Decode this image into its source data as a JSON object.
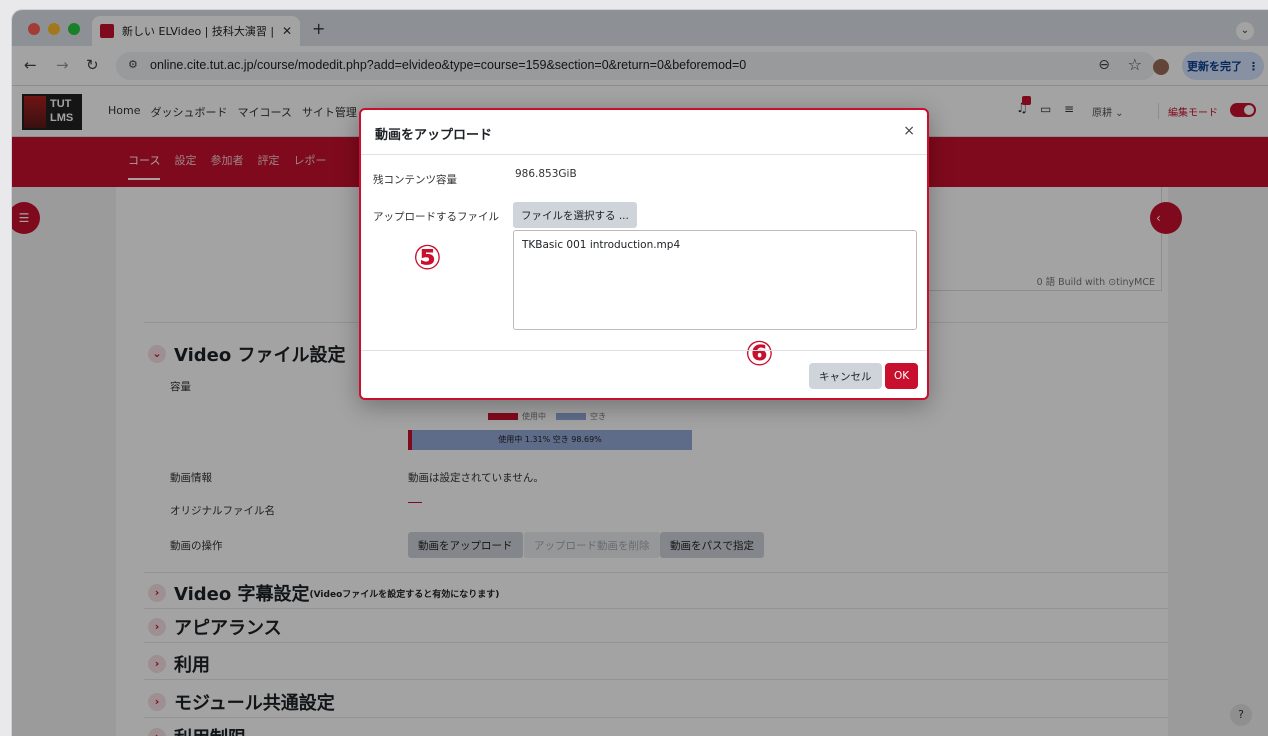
{
  "browser": {
    "tab_title": "新しい ELVideo | 技科大演習 | T",
    "new_tab": "+",
    "url": "online.cite.tut.ac.jp/course/modedit.php?add=elvideo&type=course=159&section=0&return=0&beforemod=0",
    "update_label": "更新を完了"
  },
  "header": {
    "logo_line1": "TUT",
    "logo_line2": "LMS",
    "nav": [
      "Home",
      "ダッシュボード",
      "マイコース",
      "サイト管理"
    ],
    "user_name": "原耕",
    "edit_mode_label": "編集モード"
  },
  "course_nav": {
    "items": [
      "コース",
      "設定",
      "参加者",
      "評定",
      "レポー"
    ]
  },
  "editor": {
    "status": "0 語   Build with ⊙tinyMCE"
  },
  "video_section": {
    "title": "Video ファイル設定",
    "capacity_label": "容量",
    "legend_used": "使用中",
    "legend_free": "空き",
    "quota_used_percent": 1.31,
    "quota_text": "使用中 1.31% 空き 98.69%",
    "info_label": "動画情報",
    "info_value": "動画は設定されていません。",
    "original_name_label": "オリジナルファイル名",
    "operations_label": "動画の操作",
    "btn_upload": "動画をアップロード",
    "btn_delete": "アップロード動画を削除",
    "btn_path": "動画をパスで指定"
  },
  "other_sections": [
    {
      "title": "Video 字幕設定",
      "note": "(Videoファイルを設定すると有効になります)"
    },
    {
      "title": "アピアランス",
      "note": ""
    },
    {
      "title": "利用",
      "note": ""
    },
    {
      "title": "モジュール共通設定",
      "note": ""
    },
    {
      "title": "利用制限",
      "note": ""
    }
  ],
  "help": "?",
  "modal": {
    "title": "動画をアップロード",
    "close": "×",
    "remaining_label": "残コンテンツ容量",
    "remaining_value": "986.853GiB",
    "file_label": "アップロードするファイル",
    "choose_button": "ファイルを選択する ...",
    "selected_file": "TKBasic 001 introduction.mp4",
    "cancel": "キャンセル",
    "ok": "OK",
    "marker_5": "⑤",
    "marker_6": "⑥"
  },
  "colors": {
    "brand_red": "#c8102e",
    "quota_free": "#93a9d8"
  }
}
